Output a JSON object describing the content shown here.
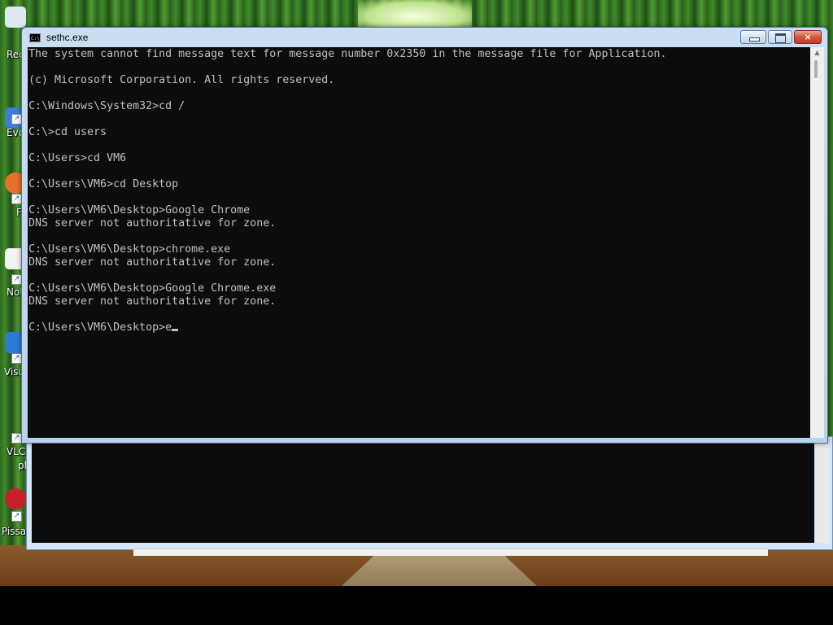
{
  "window": {
    "title": "sethc.exe",
    "buttons": {
      "minimize": "minimize",
      "maximize": "maximize",
      "close": "×"
    }
  },
  "console": {
    "lines": [
      "The system cannot find message text for message number 0x2350 in the message file for Application.",
      "",
      "(c) Microsoft Corporation. All rights reserved.",
      "",
      "C:\\Windows\\System32>cd /",
      "",
      "C:\\>cd users",
      "",
      "C:\\Users>cd VM6",
      "",
      "C:\\Users\\VM6>cd Desktop",
      "",
      "C:\\Users\\VM6\\Desktop>Google Chrome",
      "DNS server not authoritative for zone.",
      "",
      "C:\\Users\\VM6\\Desktop>chrome.exe",
      "DNS server not authoritative for zone.",
      "",
      "C:\\Users\\VM6\\Desktop>Google Chrome.exe",
      "DNS server not authoritative for zone.",
      "",
      "C:\\Users\\VM6\\Desktop>e"
    ]
  },
  "desktop_icons": [
    {
      "label": "Rec",
      "icon": "recycle-bin-icon"
    },
    {
      "label": "Eve",
      "icon": "app-shortcut-icon"
    },
    {
      "label": "F",
      "icon": "firefox-icon"
    },
    {
      "label": "Not",
      "icon": "notepad-icon"
    },
    {
      "label": "Visu",
      "icon": "visual-studio-icon"
    },
    {
      "label": "VLC",
      "icon": "vlc-icon"
    },
    {
      "label": "pl",
      "icon": "vlc-icon"
    },
    {
      "label": "Pissar",
      "icon": "app-shortcut-icon"
    }
  ],
  "colors": {
    "console_bg": "#0c0c0c",
    "console_fg": "#c0c0c0",
    "window_frame": "#b9d2ec",
    "close_button": "#c23a20"
  }
}
